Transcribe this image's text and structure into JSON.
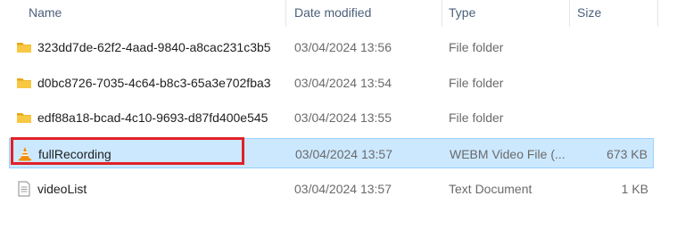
{
  "columns": {
    "name": "Name",
    "date_modified": "Date modified",
    "type": "Type",
    "size": "Size"
  },
  "sort_glyph": "^",
  "rows": [
    {
      "name": "323dd7de-62f2-4aad-9840-a8cac231c3b5",
      "date": "03/04/2024 13:56",
      "type": "File folder",
      "size": "",
      "icon": "folder-icon",
      "selected": false
    },
    {
      "name": "d0bc8726-7035-4c64-b8c3-65a3e702fba3",
      "date": "03/04/2024 13:54",
      "type": "File folder",
      "size": "",
      "icon": "folder-icon",
      "selected": false
    },
    {
      "name": "edf88a18-bcad-4c10-9693-d87fd400e545",
      "date": "03/04/2024 13:55",
      "type": "File folder",
      "size": "",
      "icon": "folder-icon",
      "selected": false
    },
    {
      "name": "fullRecording",
      "date": "03/04/2024 13:57",
      "type": "WEBM Video File (...",
      "size": "673 KB",
      "icon": "vlc-cone-icon",
      "selected": true
    },
    {
      "name": "videoList",
      "date": "03/04/2024 13:57",
      "type": "Text Document",
      "size": "1 KB",
      "icon": "text-document-icon",
      "selected": false
    }
  ],
  "colors": {
    "selection_bg": "#cce8ff",
    "selection_border": "#99d1ff",
    "annotation_red": "#e0202a",
    "folder_yellow": "#f8c843",
    "vlc_orange": "#f28c00"
  }
}
